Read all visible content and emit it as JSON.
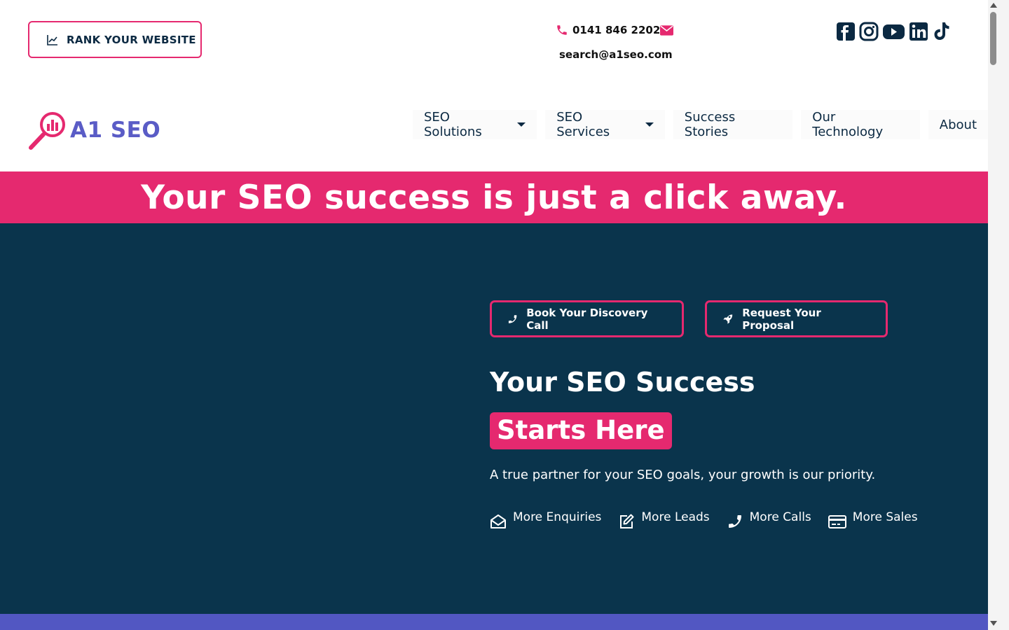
{
  "topbar": {
    "rank_button_label": "RANK YOUR WEBSITE",
    "phone": "0141 846 2202",
    "email": "search@a1seo.com",
    "social_icons": [
      "facebook-icon",
      "instagram-icon",
      "youtube-icon",
      "linkedin-icon",
      "tiktok-icon"
    ]
  },
  "brand": {
    "logo_text": "A1 SEO",
    "colors": {
      "pink": "#e5296f",
      "navy": "#0a344c",
      "indigo": "#5257c2"
    }
  },
  "nav": {
    "items": [
      {
        "label": "SEO Solutions",
        "has_dropdown": true
      },
      {
        "label": "SEO Services",
        "has_dropdown": true
      },
      {
        "label": "Success Stories",
        "has_dropdown": false
      },
      {
        "label": "Our Technology",
        "has_dropdown": false
      },
      {
        "label": "About",
        "has_dropdown": false
      }
    ]
  },
  "banner": {
    "headline": "Your SEO success is just a click away."
  },
  "hero": {
    "cta_primary": "Book Your Discovery Call",
    "cta_secondary": "Request Your Proposal",
    "title": "Your SEO Success",
    "title_highlight": "Starts Here",
    "subtitle": "A true partner for your SEO goals, your growth is our priority.",
    "benefits": [
      {
        "label": "More Enquiries",
        "icon": "envelope-open-icon"
      },
      {
        "label": "More Leads",
        "icon": "edit-icon"
      },
      {
        "label": "More Calls",
        "icon": "phone-icon"
      },
      {
        "label": "More Sales",
        "icon": "credit-card-icon"
      }
    ]
  }
}
